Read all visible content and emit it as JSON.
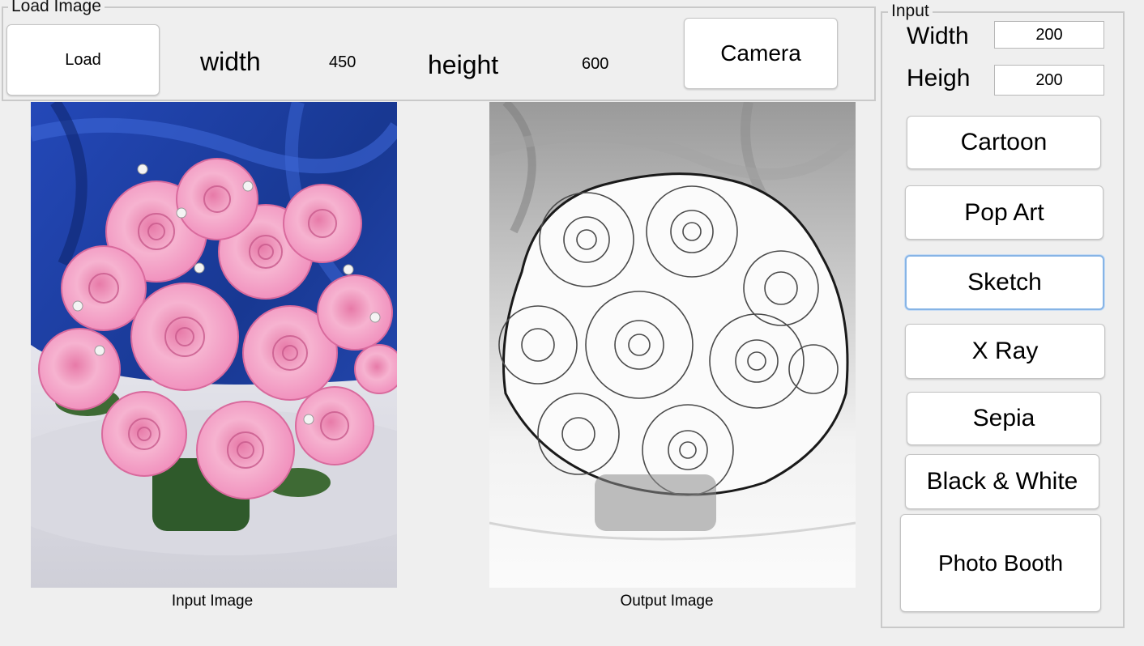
{
  "load_panel": {
    "title": "Load Image",
    "load_button": "Load",
    "width_label": "width",
    "width_value": "450",
    "height_label": "height",
    "height_value": "600",
    "camera_button": "Camera"
  },
  "images": {
    "input_caption": "Input Image",
    "output_caption": "Output Image"
  },
  "input_panel": {
    "title": "Input",
    "width_label": "Width",
    "width_value": "200",
    "height_label": "Heigh",
    "height_value": "200",
    "effects": [
      {
        "label": "Cartoon"
      },
      {
        "label": "Pop Art"
      },
      {
        "label": "Sketch"
      },
      {
        "label": "X Ray"
      },
      {
        "label": "Sepia"
      },
      {
        "label": "Black & White"
      },
      {
        "label": "Photo Booth"
      }
    ],
    "focused_effect": "Sketch"
  },
  "colors": {
    "background": "#efefef",
    "focus_ring": "#86b4e6",
    "backdrop_blue": "#1d3fa0",
    "rose_pink": "#f3a6c8"
  }
}
